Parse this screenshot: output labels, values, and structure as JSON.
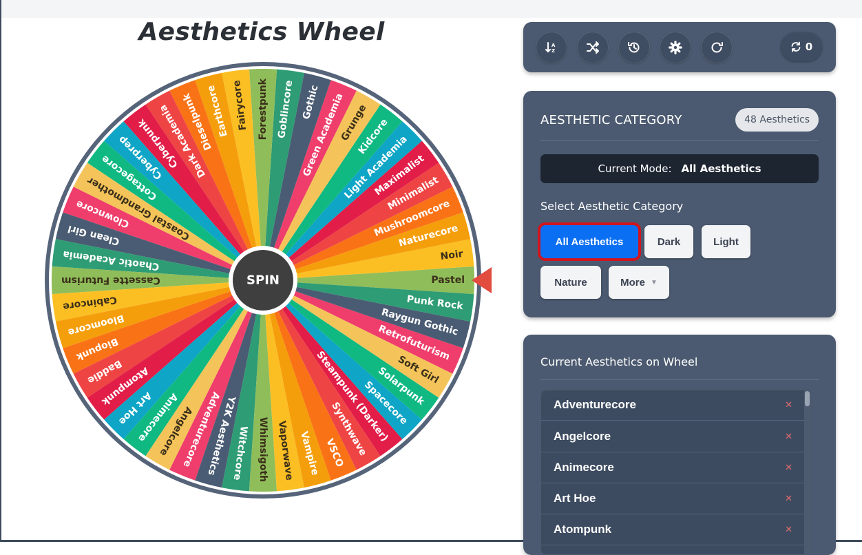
{
  "wheel": {
    "title": "Aesthetics Wheel",
    "spin_label": "SPIN",
    "pointer_color": "#e24c3f",
    "labels": [
      "Pastel",
      "Noir",
      "Naturecore",
      "Mushroomcore",
      "Minimalist",
      "Maximalist",
      "Light Academia",
      "Kidcore",
      "Grunge",
      "Green Academia",
      "Gothic",
      "Goblincore",
      "Forestpunk",
      "Fairycore",
      "Earthcore",
      "Dieselpunk",
      "Dark Academia",
      "Cyberpunk",
      "Cyberprep",
      "Cottagecore",
      "Coastal Grandmother",
      "Clowncore",
      "Clean Girl",
      "Chaotic Academia",
      "Cassette Futurism",
      "Cabincore",
      "Bloomcore",
      "Biopunk",
      "Baddie",
      "Atompunk",
      "Art Hoe",
      "Animecore",
      "Angelcore",
      "Adventurecore",
      "Y2K Aesthetics",
      "Witchcore",
      "Whimsigoth",
      "Vaporwave",
      "Vampire",
      "VSCO",
      "Synthwave",
      "Steampunk (Darker)",
      "Spacecore",
      "Solarpunk",
      "Soft Girl",
      "Retrofuturism",
      "Raygun Gothic",
      "Punk Rock"
    ],
    "colors": [
      "#8fbd5a",
      "#fbbf24",
      "#f59e0b",
      "#f97316",
      "#ef4444",
      "#e11d48",
      "#0ea5c6",
      "#10b981",
      "#f4c45a",
      "#ef3e6b",
      "#4a5c73",
      "#2e9c74",
      "#8fbd5a",
      "#fbbf24",
      "#f59e0b",
      "#f97316",
      "#ef4444",
      "#e11d48",
      "#0ea5c6",
      "#10b981",
      "#f4c45a",
      "#ef3e6b",
      "#4a5c73",
      "#2e9c74"
    ]
  },
  "toolbar": {
    "buttons": [
      {
        "icon": "sort-alpha-icon"
      },
      {
        "icon": "shuffle-icon"
      },
      {
        "icon": "history-icon"
      },
      {
        "icon": "gear-icon"
      },
      {
        "icon": "redo-icon"
      }
    ],
    "spin_count": "0"
  },
  "category": {
    "title": "AESTHETIC CATEGORY",
    "count_badge": "48 Aesthetics",
    "mode_label": "Current Mode:",
    "mode_value": "All Aesthetics",
    "select_label": "Select Aesthetic Category",
    "buttons": {
      "all": "All Aesthetics",
      "dark": "Dark",
      "light": "Light",
      "nature": "Nature",
      "more": "More"
    }
  },
  "current": {
    "title": "Current Aesthetics on Wheel",
    "items": [
      "Adventurecore",
      "Angelcore",
      "Animecore",
      "Art Hoe",
      "Atompunk"
    ],
    "remove_glyph": "✕"
  }
}
